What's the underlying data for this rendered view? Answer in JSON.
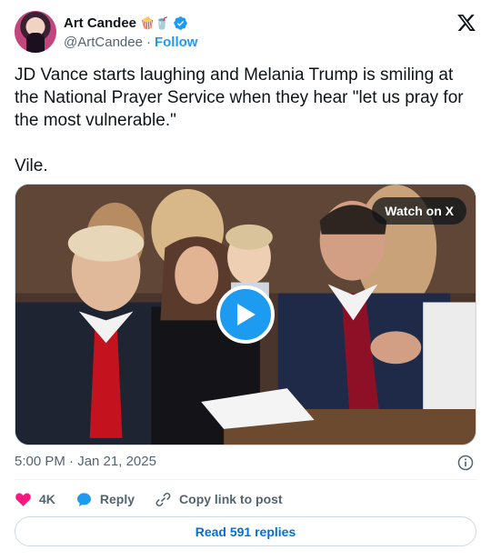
{
  "author": {
    "display_name": "Art Candee",
    "emoji": "🍿🥤",
    "handle": "@ArtCandee",
    "separator": "·",
    "follow_label": "Follow"
  },
  "tweet": {
    "text": "JD Vance starts laughing and Melania Trump is smiling at the National Prayer Service when they hear \"let us pray for the most vulnerable.\"\n\nVile."
  },
  "media": {
    "watch_label": "Watch on X"
  },
  "meta": {
    "timestamp": "5:00 PM · Jan 21, 2025"
  },
  "actions": {
    "like_count": "4K",
    "reply_label": "Reply",
    "copy_label": "Copy link to post"
  },
  "footer": {
    "read_replies_label": "Read 591 replies"
  },
  "colors": {
    "accent": "#1d9bf0",
    "like": "#f91880",
    "link": "#006fd6",
    "muted": "#536471"
  },
  "icons": [
    "verified-icon",
    "x-logo-icon",
    "play-icon",
    "info-icon",
    "heart-icon",
    "reply-icon",
    "link-icon"
  ]
}
